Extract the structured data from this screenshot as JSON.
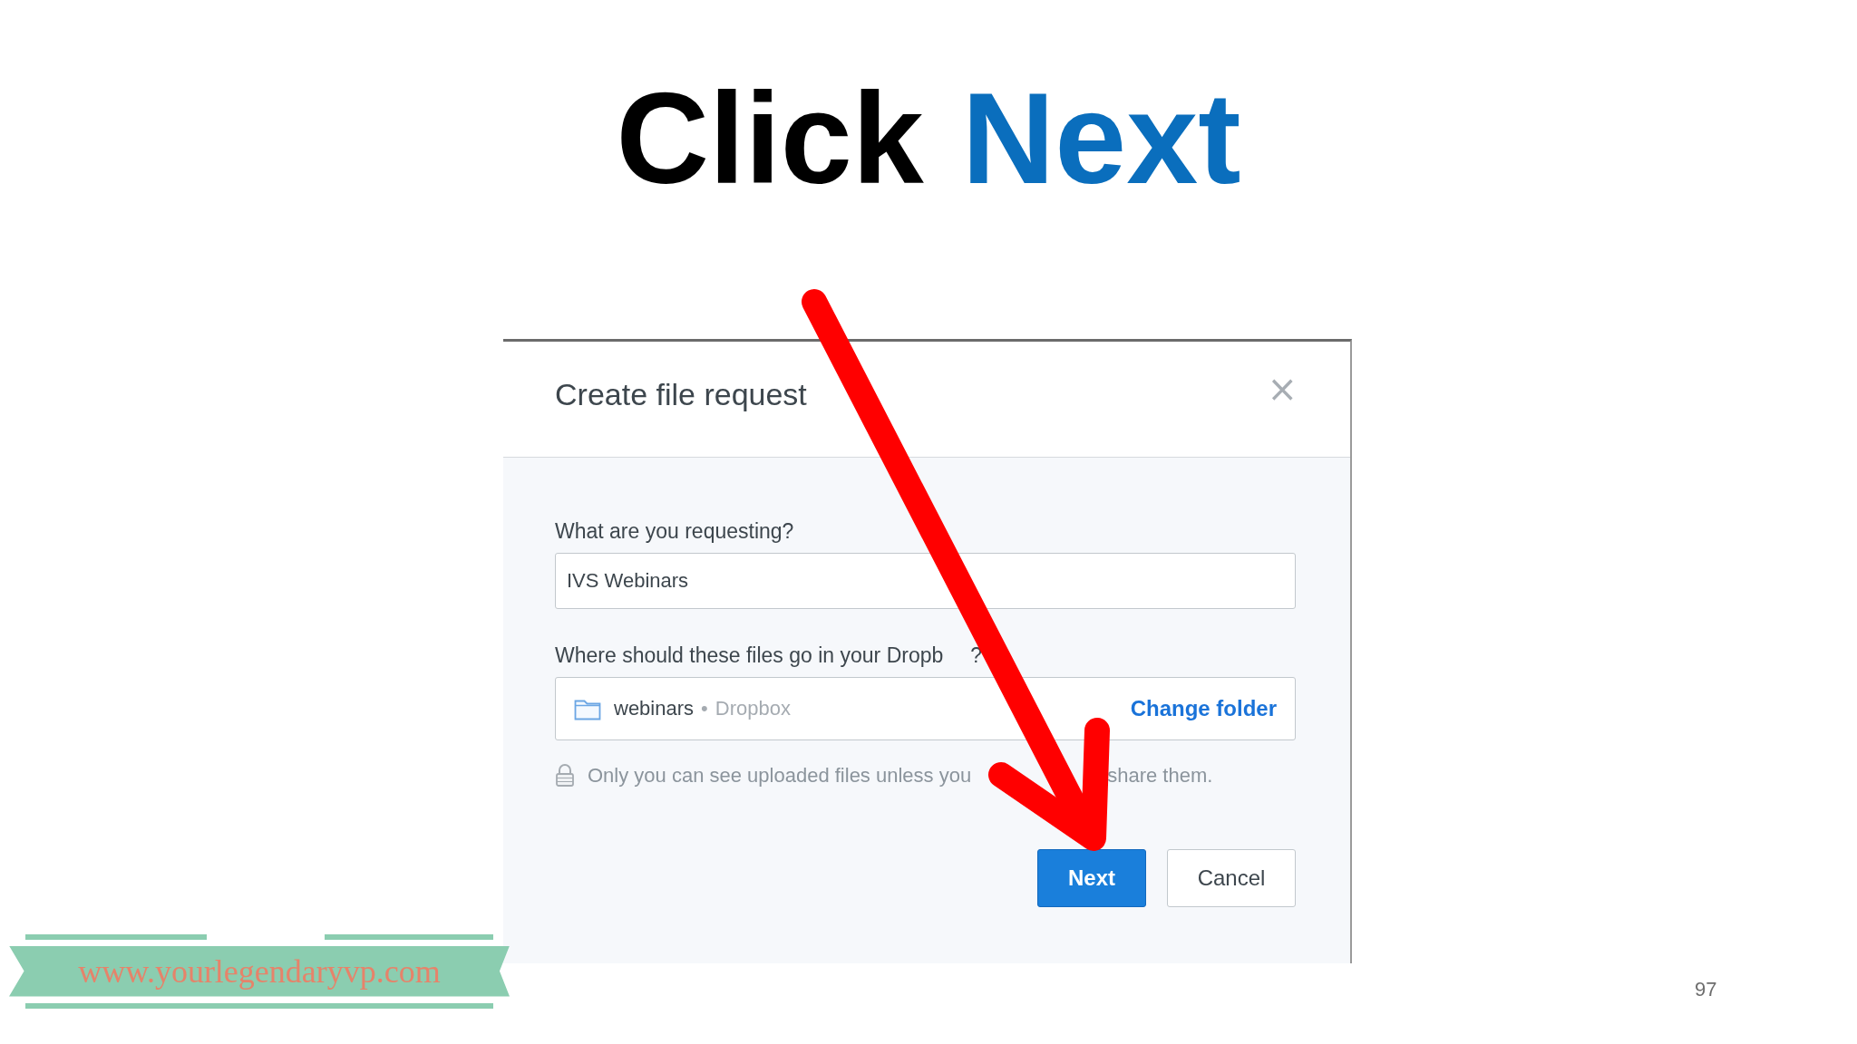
{
  "slide": {
    "title_words": [
      {
        "text": "Click",
        "color": "#000000"
      },
      {
        "text": "Next",
        "color": "#0a6ebd"
      }
    ],
    "page_number": "97",
    "banner": {
      "text": "www.yourlegendaryvp.com"
    }
  },
  "dialog": {
    "title": "Create file request",
    "close": "×",
    "request_label": "What are you requesting?",
    "request_value": "IVS Webinars",
    "destination_label_parts": [
      "Where should these files go in your Dropb",
      "?"
    ],
    "folder": {
      "name": "webinars",
      "separator": "•",
      "location": "Dropbox",
      "action": "Change folder"
    },
    "privacy_note_parts": [
      "Only you can see uploaded files unless you",
      "share them."
    ],
    "buttons": [
      {
        "label": "Next",
        "kind": "primary"
      },
      {
        "label": "Cancel",
        "kind": "secondary"
      }
    ]
  }
}
